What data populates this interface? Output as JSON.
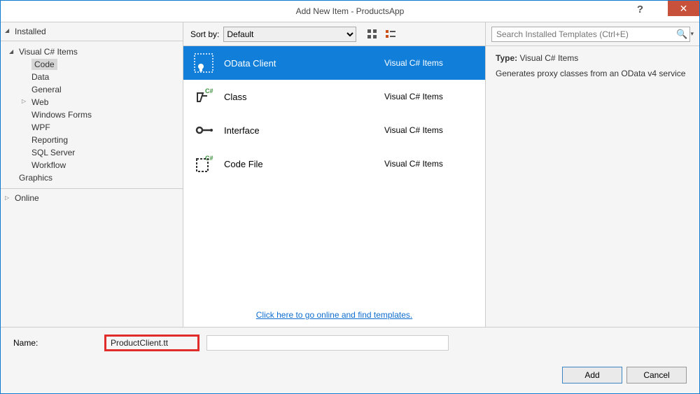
{
  "title": "Add New Item - ProductsApp",
  "sidebar": {
    "installed_label": "Installed",
    "online_label": "Online",
    "csharp_items": "Visual C# Items",
    "children": {
      "code": "Code",
      "data": "Data",
      "general": "General",
      "web": "Web",
      "winforms": "Windows Forms",
      "wpf": "WPF",
      "reporting": "Reporting",
      "sqlserver": "SQL Server",
      "workflow": "Workflow"
    },
    "graphics": "Graphics"
  },
  "sortbar": {
    "label": "Sort by:",
    "value": "Default"
  },
  "search": {
    "placeholder": "Search Installed Templates (Ctrl+E)"
  },
  "templates": [
    {
      "label": "OData Client",
      "lang": "Visual C# Items"
    },
    {
      "label": "Class",
      "lang": "Visual C# Items"
    },
    {
      "label": "Interface",
      "lang": "Visual C# Items"
    },
    {
      "label": "Code File",
      "lang": "Visual C# Items"
    }
  ],
  "online_link": "Click here to go online and find templates.",
  "detail": {
    "type_label": "Type:",
    "type_value": "Visual C# Items",
    "description": "Generates proxy classes from an OData v4 service"
  },
  "name_row": {
    "label": "Name:",
    "value": "ProductClient.tt"
  },
  "buttons": {
    "add": "Add",
    "cancel": "Cancel"
  }
}
